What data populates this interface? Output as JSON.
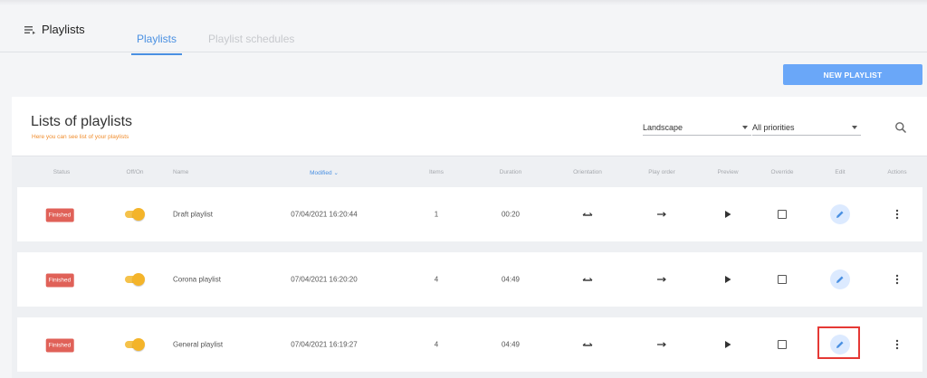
{
  "header": {
    "title": "Playlists",
    "tabs": [
      "Playlists",
      "Playlist schedules"
    ],
    "active_tab": 0
  },
  "new_button_label": "NEW PLAYLIST",
  "list": {
    "title": "Lists of playlists",
    "subtitle": "Here you can see list of your playlists"
  },
  "filters": {
    "orientation": "Landscape",
    "priority": "All priorities"
  },
  "columns": [
    "Status",
    "Off/On",
    "Name",
    "Modified",
    "Items",
    "Duration",
    "Orientation",
    "Play order",
    "Preview",
    "Override",
    "Edit",
    "Actions"
  ],
  "sort_column": "Modified",
  "rows": [
    {
      "status": "Finished",
      "enabled": true,
      "name": "Draft playlist",
      "modified": "07/04/2021 16:20:44",
      "items": "1",
      "duration": "00:20",
      "override": false
    },
    {
      "status": "Finished",
      "enabled": true,
      "name": "Corona playlist",
      "modified": "07/04/2021 16:20:20",
      "items": "4",
      "duration": "04:49",
      "override": false
    },
    {
      "status": "Finished",
      "enabled": true,
      "name": "General playlist",
      "modified": "07/04/2021 16:19:27",
      "items": "4",
      "duration": "04:49",
      "override": false
    }
  ],
  "icons": {
    "menu": "menu-icon",
    "search": "search-icon",
    "orientation": "swap-arrows-icon",
    "play_order": "arrow-right-icon",
    "preview": "play-icon",
    "edit": "pencil-icon",
    "actions": "more-vertical-icon",
    "sort": "chevron-down-icon"
  },
  "colors": {
    "accent": "#4a90e2",
    "button": "#6aa7f8",
    "status_finished": "#e06158",
    "toggle_on": "#f4b42a",
    "subtitle": "#f08c2c",
    "highlight": "#e53935"
  }
}
